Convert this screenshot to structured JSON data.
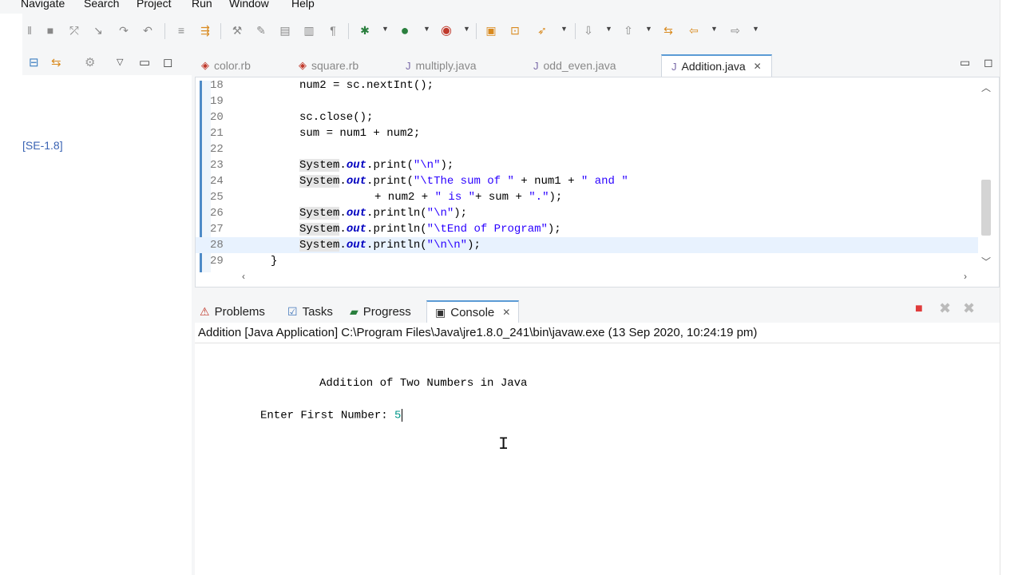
{
  "menu": [
    "Navigate",
    "Search",
    "Project",
    "Run",
    "Window",
    "Help"
  ],
  "package_explorer": {
    "tree_item": "[SE-1.8]"
  },
  "editor": {
    "tabs": [
      {
        "label": "color.rb",
        "icon": "ruby-file-icon",
        "active": false
      },
      {
        "label": "square.rb",
        "icon": "ruby-file-icon",
        "active": false
      },
      {
        "label": "multiply.java",
        "icon": "java-file-icon",
        "active": false
      },
      {
        "label": "odd_even.java",
        "icon": "java-file-icon",
        "active": false
      },
      {
        "label": "Addition.java",
        "icon": "java-file-icon",
        "active": true
      }
    ],
    "lines": [
      {
        "num": "18",
        "text": "num2 = sc.nextInt();"
      },
      {
        "num": "19",
        "text": ""
      },
      {
        "num": "20",
        "text": "sc.close();"
      },
      {
        "num": "21",
        "text": "sum = num1 + num2;"
      },
      {
        "num": "22",
        "text": ""
      },
      {
        "num": "23",
        "text": "System.out.print(\"\\n\");"
      },
      {
        "num": "24",
        "text": "System.out.print(\"\\tThe sum of \" + num1 + \" and \""
      },
      {
        "num": "25",
        "text": "        + num2 + \" is \"+ sum + \".\");"
      },
      {
        "num": "26",
        "text": "System.out.println(\"\\n\");"
      },
      {
        "num": "27",
        "text": "System.out.println(\"\\tEnd of Program\");"
      },
      {
        "num": "28",
        "text": "System.out.println(\"\\n\\n\");"
      },
      {
        "num": "29",
        "text": "}"
      }
    ]
  },
  "bottom_panel": {
    "tabs": [
      {
        "label": "Problems",
        "icon": "problems-icon",
        "active": false
      },
      {
        "label": "Tasks",
        "icon": "tasks-icon",
        "active": false
      },
      {
        "label": "Progress",
        "icon": "progress-icon",
        "active": false
      },
      {
        "label": "Console",
        "icon": "console-icon",
        "active": true
      }
    ],
    "console_info": "Addition [Java Application] C:\\Program Files\\Java\\jre1.8.0_241\\bin\\javaw.exe (13 Sep 2020, 10:24:19 pm)",
    "console_title_line": "Addition of Two Numbers in Java",
    "console_prompt": "Enter First Number: ",
    "console_input": "5"
  },
  "colors": {
    "active_tab_border": "#5b9bd5",
    "keyword": "#7f0055",
    "string": "#2a00ff",
    "field": "#0000c0",
    "console_input": "#009688"
  }
}
